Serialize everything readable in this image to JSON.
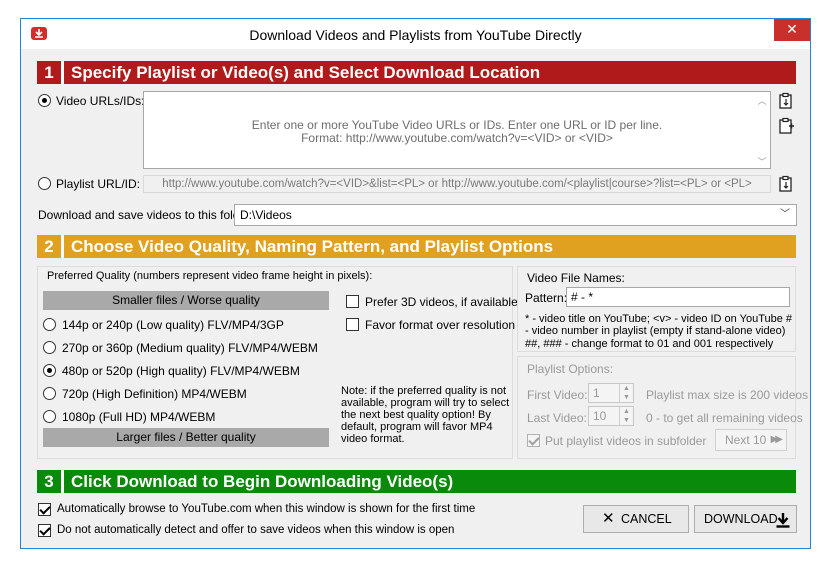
{
  "window": {
    "title": "Download Videos and Playlists from YouTube Directly",
    "close_glyph": "✕"
  },
  "section1": {
    "number": "1",
    "title": "Specify Playlist or Video(s) and Select Download Location",
    "video_urls_label": "Video URLs/IDs:",
    "video_urls_placeholder_line1": "Enter one or more YouTube Video URLs or IDs. Enter one URL or ID per line.",
    "video_urls_placeholder_line2": "Format: http://www.youtube.com/watch?v=<VID> or <VID>",
    "playlist_label": "Playlist URL/ID:",
    "playlist_placeholder": "http://www.youtube.com/watch?v=<VID>&list=<PL> or http://www.youtube.com/<playlist|course>?list=<PL> or <PL>",
    "folder_label": "Download and save videos to this folder:",
    "folder_value": "D:\\Videos"
  },
  "section2": {
    "number": "2",
    "title": "Choose Video Quality, Naming Pattern, and Playlist Options",
    "quality_legend": "Preferred Quality (numbers represent video frame height in pixels):",
    "smaller_files_label": "Smaller files / Worse quality",
    "larger_files_label": "Larger files / Better quality",
    "quality_options": [
      "144p or 240p (Low quality) FLV/MP4/3GP",
      "270p or 360p (Medium quality) FLV/MP4/WEBM",
      "480p or 520p (High quality) FLV/MP4/WEBM",
      "720p (High Definition) MP4/WEBM",
      "1080p (Full HD) MP4/WEBM"
    ],
    "selected_quality": "480p or 520p (High quality) FLV/MP4/WEBM",
    "prefer_3d_label": "Prefer 3D videos, if available",
    "favor_format_label": "Favor format over resolution",
    "note_text": "Note: if the preferred quality is not available, program will try to select the next best quality option! By default, program will favor MP4 video format.",
    "file_names_legend": "Video File Names:",
    "pattern_label": "Pattern:",
    "pattern_value": "# - *",
    "pattern_help": "* - video title on YouTube; <v> - video ID on YouTube # - video number in playlist (empty if stand-alone video) ##, ### - change format to 01 and 001 respectively",
    "playlist_legend": "Playlist Options:",
    "first_video_label": "First Video:",
    "first_video_value": "1",
    "max_size_text": "Playlist max size is 200 videos",
    "last_video_label": "Last Video:",
    "last_video_value": "10",
    "last_video_hint": "0 - to get all remaining videos",
    "subfolder_label": "Put playlist videos in subfolder",
    "next_label": "Next 10"
  },
  "section3": {
    "number": "3",
    "title": "Click Download to Begin Downloading Video(s)",
    "auto_browse_label": "Automatically browse to YouTube.com when this window is shown for the first time",
    "no_detect_label": "Do not automatically detect and offer to save videos when this window is open",
    "cancel_label": "CANCEL",
    "download_label": "DOWNLOAD"
  }
}
